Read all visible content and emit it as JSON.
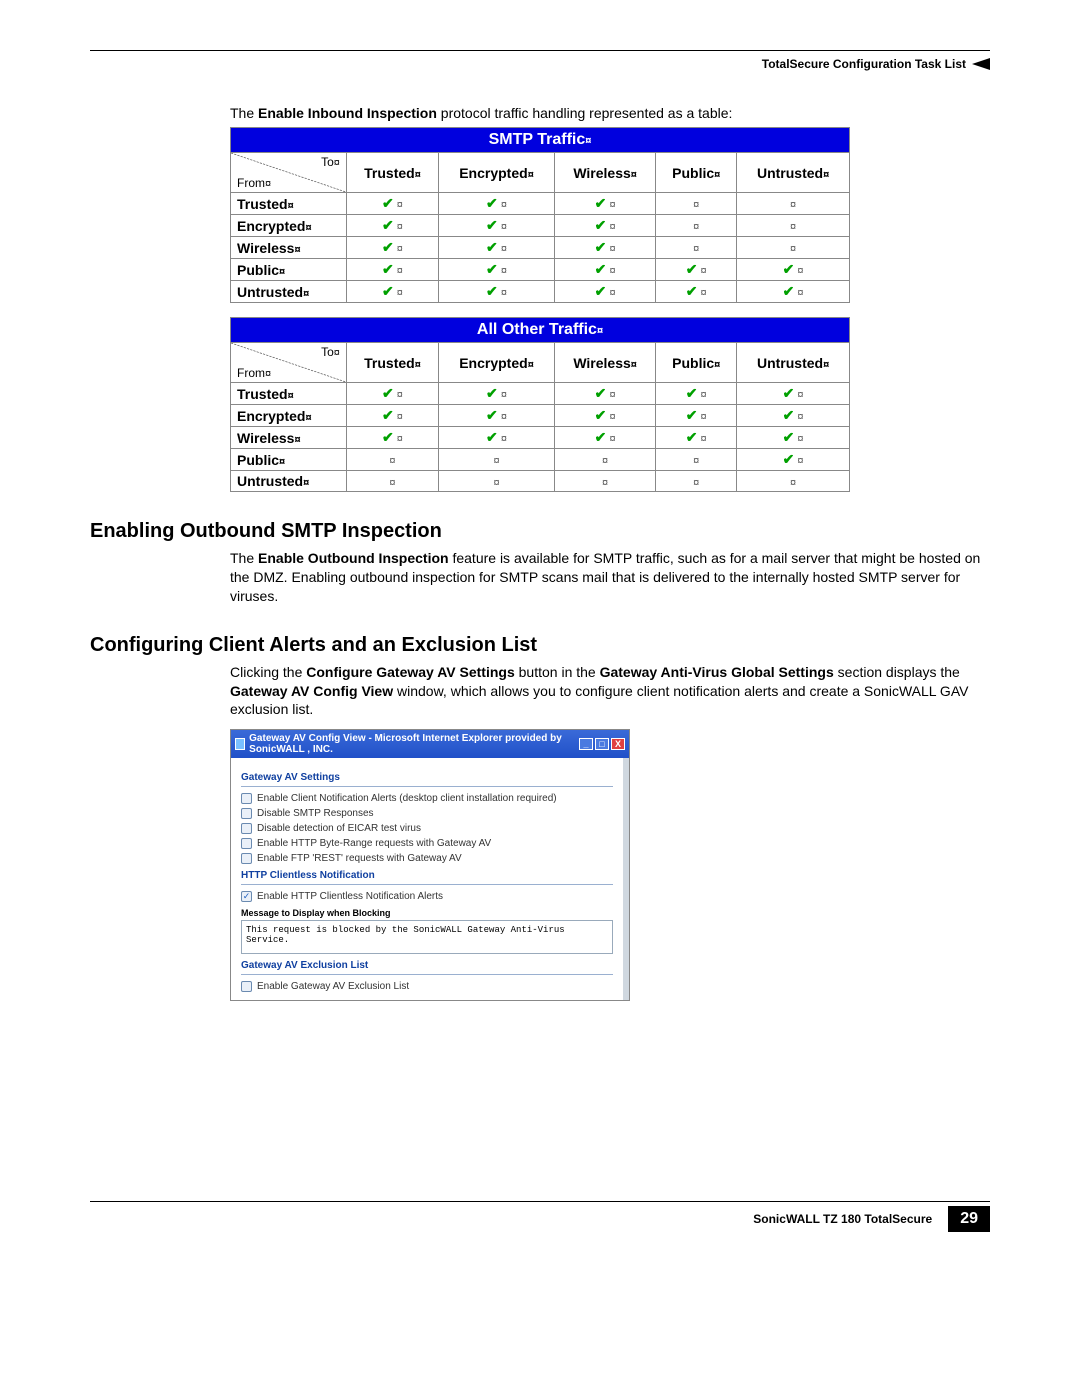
{
  "header": {
    "title": "TotalSecure Configuration Task List"
  },
  "intro_text": {
    "prefix": "The ",
    "bold": "Enable Inbound Inspection",
    "suffix": " protocol traffic handling represented as a table:"
  },
  "table_corner": {
    "to": "To",
    "from": "From"
  },
  "columns": [
    "Trusted",
    "Encrypted",
    "Wireless",
    "Public",
    "Untrusted"
  ],
  "row_labels": [
    "Trusted",
    "Encrypted",
    "Wireless",
    "Public",
    "Untrusted"
  ],
  "tables": [
    {
      "title": "SMTP Traffic",
      "data": [
        [
          "y",
          "y",
          "y",
          "n",
          "n"
        ],
        [
          "y",
          "y",
          "y",
          "n",
          "n"
        ],
        [
          "y",
          "y",
          "y",
          "n",
          "n"
        ],
        [
          "y",
          "y",
          "y",
          "y",
          "y"
        ],
        [
          "y",
          "y",
          "y",
          "y",
          "y"
        ]
      ]
    },
    {
      "title": "All Other Traffic",
      "data": [
        [
          "y",
          "y",
          "y",
          "y",
          "y"
        ],
        [
          "y",
          "y",
          "y",
          "y",
          "y"
        ],
        [
          "y",
          "y",
          "y",
          "y",
          "y"
        ],
        [
          "n",
          "n",
          "n",
          "n",
          "y"
        ],
        [
          "n",
          "n",
          "n",
          "n",
          "n"
        ]
      ]
    }
  ],
  "sections": {
    "outbound": {
      "heading": "Enabling Outbound SMTP Inspection",
      "para_prefix": "The ",
      "para_bold": "Enable Outbound Inspection",
      "para_suffix": " feature is available for SMTP traffic, such as for a mail server that might be hosted on the DMZ. Enabling outbound inspection for SMTP scans mail that is delivered to the internally hosted SMTP server for viruses."
    },
    "alerts": {
      "heading": "Configuring Client Alerts and an Exclusion List",
      "p1_a": "Clicking the ",
      "p1_b": "Configure Gateway AV Settings",
      "p1_c": " button in the ",
      "p1_d": "Gateway Anti-Virus Global Settings",
      "p1_e": " section displays the ",
      "p1_f": "Gateway AV Config View",
      "p1_g": " window, which allows you to configure client notification alerts and create a SonicWALL GAV exclusion list."
    }
  },
  "screenshot": {
    "window_title": "Gateway AV Config View - Microsoft Internet Explorer provided by SonicWALL , INC.",
    "h1": "Gateway AV Settings",
    "opts": [
      {
        "txt": "Enable Client Notification Alerts (desktop client installation required)",
        "on": false
      },
      {
        "txt": "Disable SMTP Responses",
        "on": false
      },
      {
        "txt": "Disable detection of EICAR test virus",
        "on": false
      },
      {
        "txt": "Enable HTTP Byte-Range requests with Gateway AV",
        "on": false
      },
      {
        "txt": "Enable FTP 'REST' requests with Gateway AV",
        "on": false
      }
    ],
    "h2": "HTTP Clientless Notification",
    "opt2": {
      "txt": "Enable HTTP Clientless Notification Alerts",
      "on": true
    },
    "msg_label": "Message to Display when Blocking",
    "msg_value": "This request is blocked by the SonicWALL Gateway Anti-Virus Service.",
    "h3": "Gateway AV Exclusion List",
    "opt3": {
      "txt": "Enable Gateway AV Exclusion List",
      "on": false
    }
  },
  "footer": {
    "product": "SonicWALL TZ 180 TotalSecure",
    "page": "29"
  }
}
